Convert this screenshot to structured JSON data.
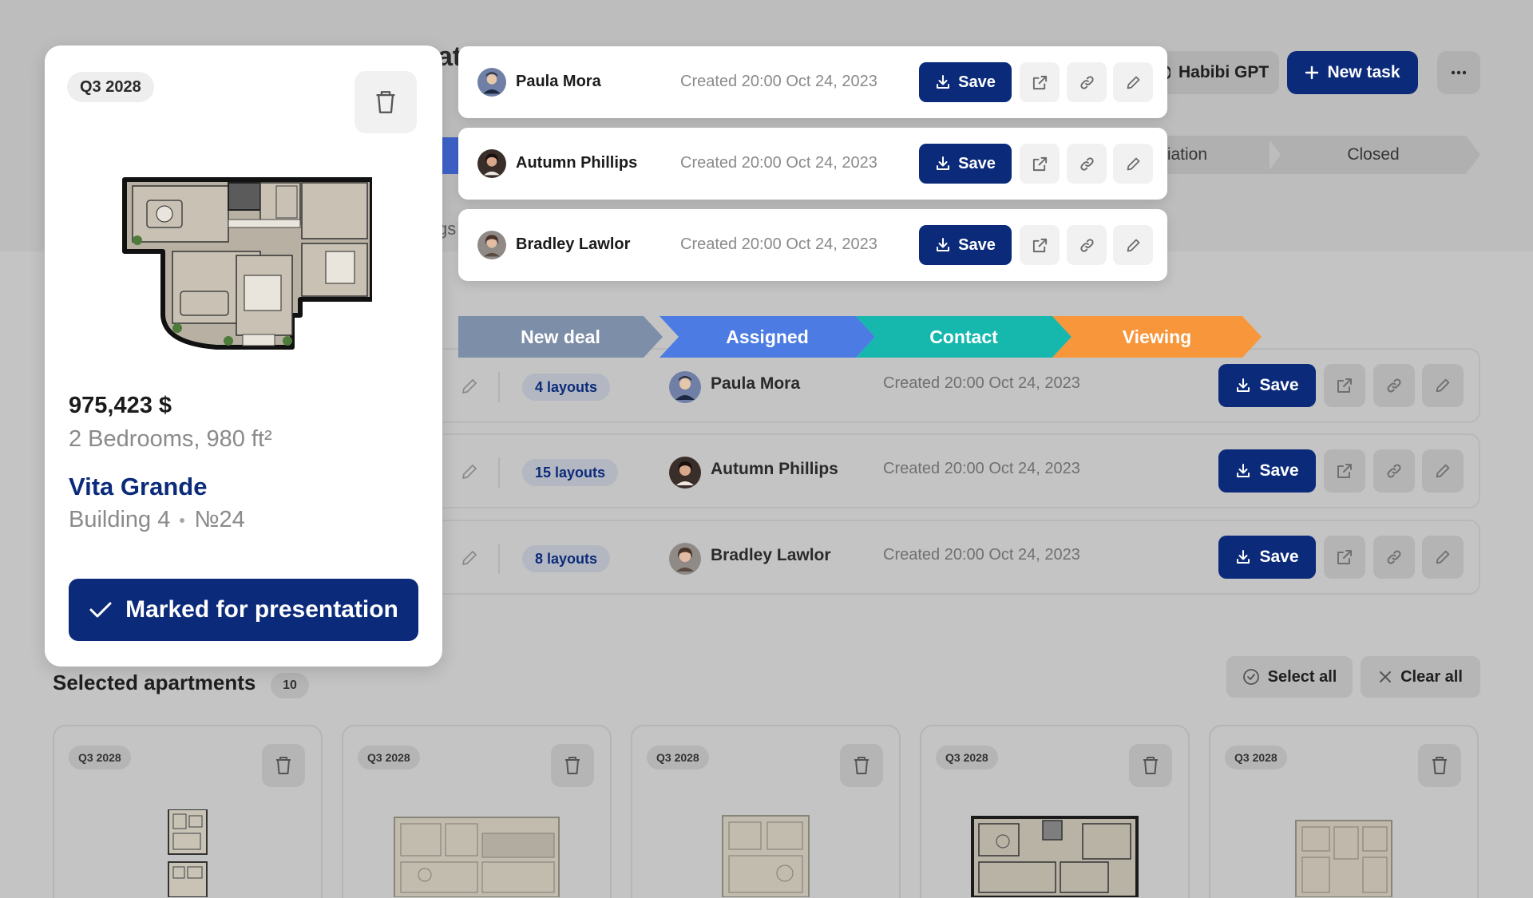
{
  "header": {
    "title_fragment": "at",
    "tabs_fragment": "gs",
    "gpt_label": "Habibi GPT",
    "new_task_label": "New task"
  },
  "pipeline": {
    "stages": [
      "New deal",
      "Assigned",
      "Contact",
      "Viewing"
    ],
    "background_stages": [
      "tiation",
      "Closed"
    ],
    "colors": [
      "#7d8ea8",
      "#4c7ce3",
      "#16b8ae",
      "#f7963a"
    ]
  },
  "deals": [
    {
      "name": "Paula Mora",
      "created": "Created 20:00 Oct 24, 2023",
      "layouts": "4 layouts",
      "save_label": "Save"
    },
    {
      "name": "Autumn Phillips",
      "created": "Created 20:00 Oct 24, 2023",
      "layouts": "15 layouts",
      "save_label": "Save"
    },
    {
      "name": "Bradley Lawlor",
      "created": "Created 20:00 Oct 24, 2023",
      "layouts": "8 layouts",
      "save_label": "Save"
    }
  ],
  "detail": {
    "quarter": "Q3 2028",
    "price": "975,423 $",
    "rooms": "2 Bedrooms, 980 ft²",
    "project": "Vita Grande",
    "building": "Building 4",
    "unit": "№24",
    "mark_label": "Marked for presentation"
  },
  "selected": {
    "title": "Selected apartments",
    "count": "10",
    "select_all_label": "Select all",
    "clear_all_label": "Clear all",
    "cards": [
      {
        "quarter": "Q3 2028"
      },
      {
        "quarter": "Q3 2028"
      },
      {
        "quarter": "Q3 2028"
      },
      {
        "quarter": "Q3 2028"
      },
      {
        "quarter": "Q3 2028"
      }
    ]
  },
  "colors": {
    "brand": "#0b2b7a",
    "overlay": "#c4c4c4"
  }
}
